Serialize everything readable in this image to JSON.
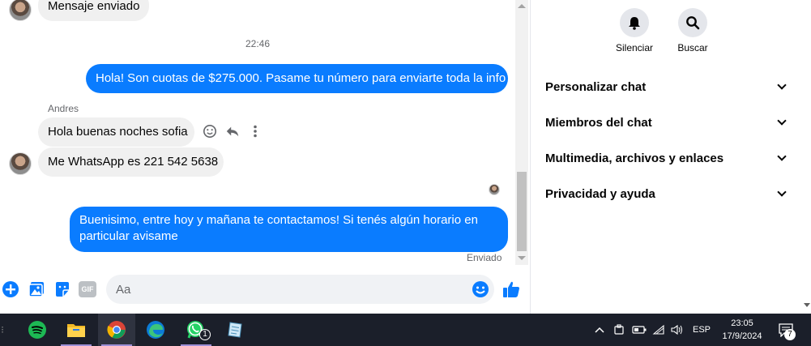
{
  "chat": {
    "top_message": "Mensaje enviado",
    "timestamp": "22:46",
    "outgoing_1": "Hola! Son cuotas de $275.000. Pasame tu número para enviarte toda la info",
    "sender_name": "Andres",
    "incoming_1": "Hola buenas noches sofia",
    "incoming_2": "Me WhatsApp es 221 542 5638",
    "outgoing_2": "Buenisimo, entre hoy y mañana te contactamos! Si tenés algún horario en particular avisame",
    "status": "Enviado"
  },
  "composer": {
    "placeholder": "Aa",
    "gif_label": "GIF"
  },
  "panel": {
    "actions": [
      {
        "label": "Silenciar",
        "icon": "bell-icon"
      },
      {
        "label": "Buscar",
        "icon": "search-icon"
      }
    ],
    "sections": [
      {
        "label": "Personalizar chat"
      },
      {
        "label": "Miembros del chat"
      },
      {
        "label": "Multimedia, archivos y enlaces"
      },
      {
        "label": "Privacidad y ayuda"
      }
    ]
  },
  "taskbar": {
    "apps": [
      "spotify-icon",
      "file-explorer-icon",
      "chrome-icon",
      "edge-icon",
      "whatsapp-icon",
      "notes-icon"
    ],
    "whatsapp_badge": "1",
    "language": "ESP",
    "time": "23:05",
    "date": "17/9/2024",
    "notification_count": "7"
  },
  "colors": {
    "messenger_blue": "#0a7cff",
    "bubble_gray": "#f0f0f0",
    "taskbar_bg": "#1b1f2a"
  }
}
